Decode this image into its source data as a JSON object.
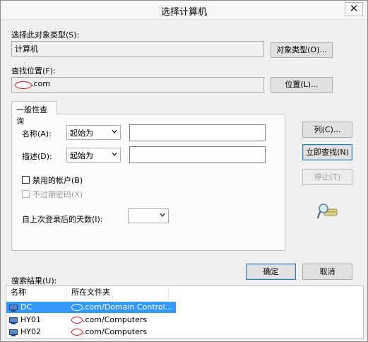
{
  "window": {
    "title": "选择计算机",
    "close_glyph": "✕"
  },
  "object_type": {
    "label": "选择此对象类型(S):",
    "value": "计算机",
    "button": "对象类型(O)..."
  },
  "location": {
    "label": "查找位置(F):",
    "value_suffix": ".com",
    "button": "位置(L)..."
  },
  "tab": {
    "label": "一般性查询"
  },
  "query": {
    "name_label": "名称(A):",
    "name_mode": "起始为",
    "name_value": "",
    "desc_label": "描述(D):",
    "desc_mode": "起始为",
    "desc_value": "",
    "disabled_accounts_label": "禁用的帐户(B)",
    "disabled_accounts_checked": false,
    "non_expiring_pw_label": "不过期密码(X)",
    "non_expiring_pw_checked": false,
    "days_label": "自上次登录后的天数(I):",
    "days_value": ""
  },
  "side_buttons": {
    "columns": "列(C)...",
    "find_now": "立即查找(N)",
    "stop": "停止(T)"
  },
  "dialog_buttons": {
    "ok": "确定",
    "cancel": "取消"
  },
  "results": {
    "label": "搜索结果(U):",
    "columns": [
      "名称",
      "所在文件夹"
    ],
    "rows": [
      {
        "name": "DC",
        "folder": ".com/Domain Control...",
        "selected": true
      },
      {
        "name": "HY01",
        "folder": ".com/Computers",
        "selected": false
      },
      {
        "name": "HY02",
        "folder": ".com/Computers",
        "selected": false
      }
    ]
  },
  "colors": {
    "selection": "#3399ff",
    "redaction": "#d21a1a",
    "default_button_border": "#3c7fb1"
  },
  "icons": {
    "close": "close-icon",
    "dropdown": "chevron-down-icon",
    "search_tool": "magnifier-tool-icon",
    "computer": "computer-icon"
  }
}
